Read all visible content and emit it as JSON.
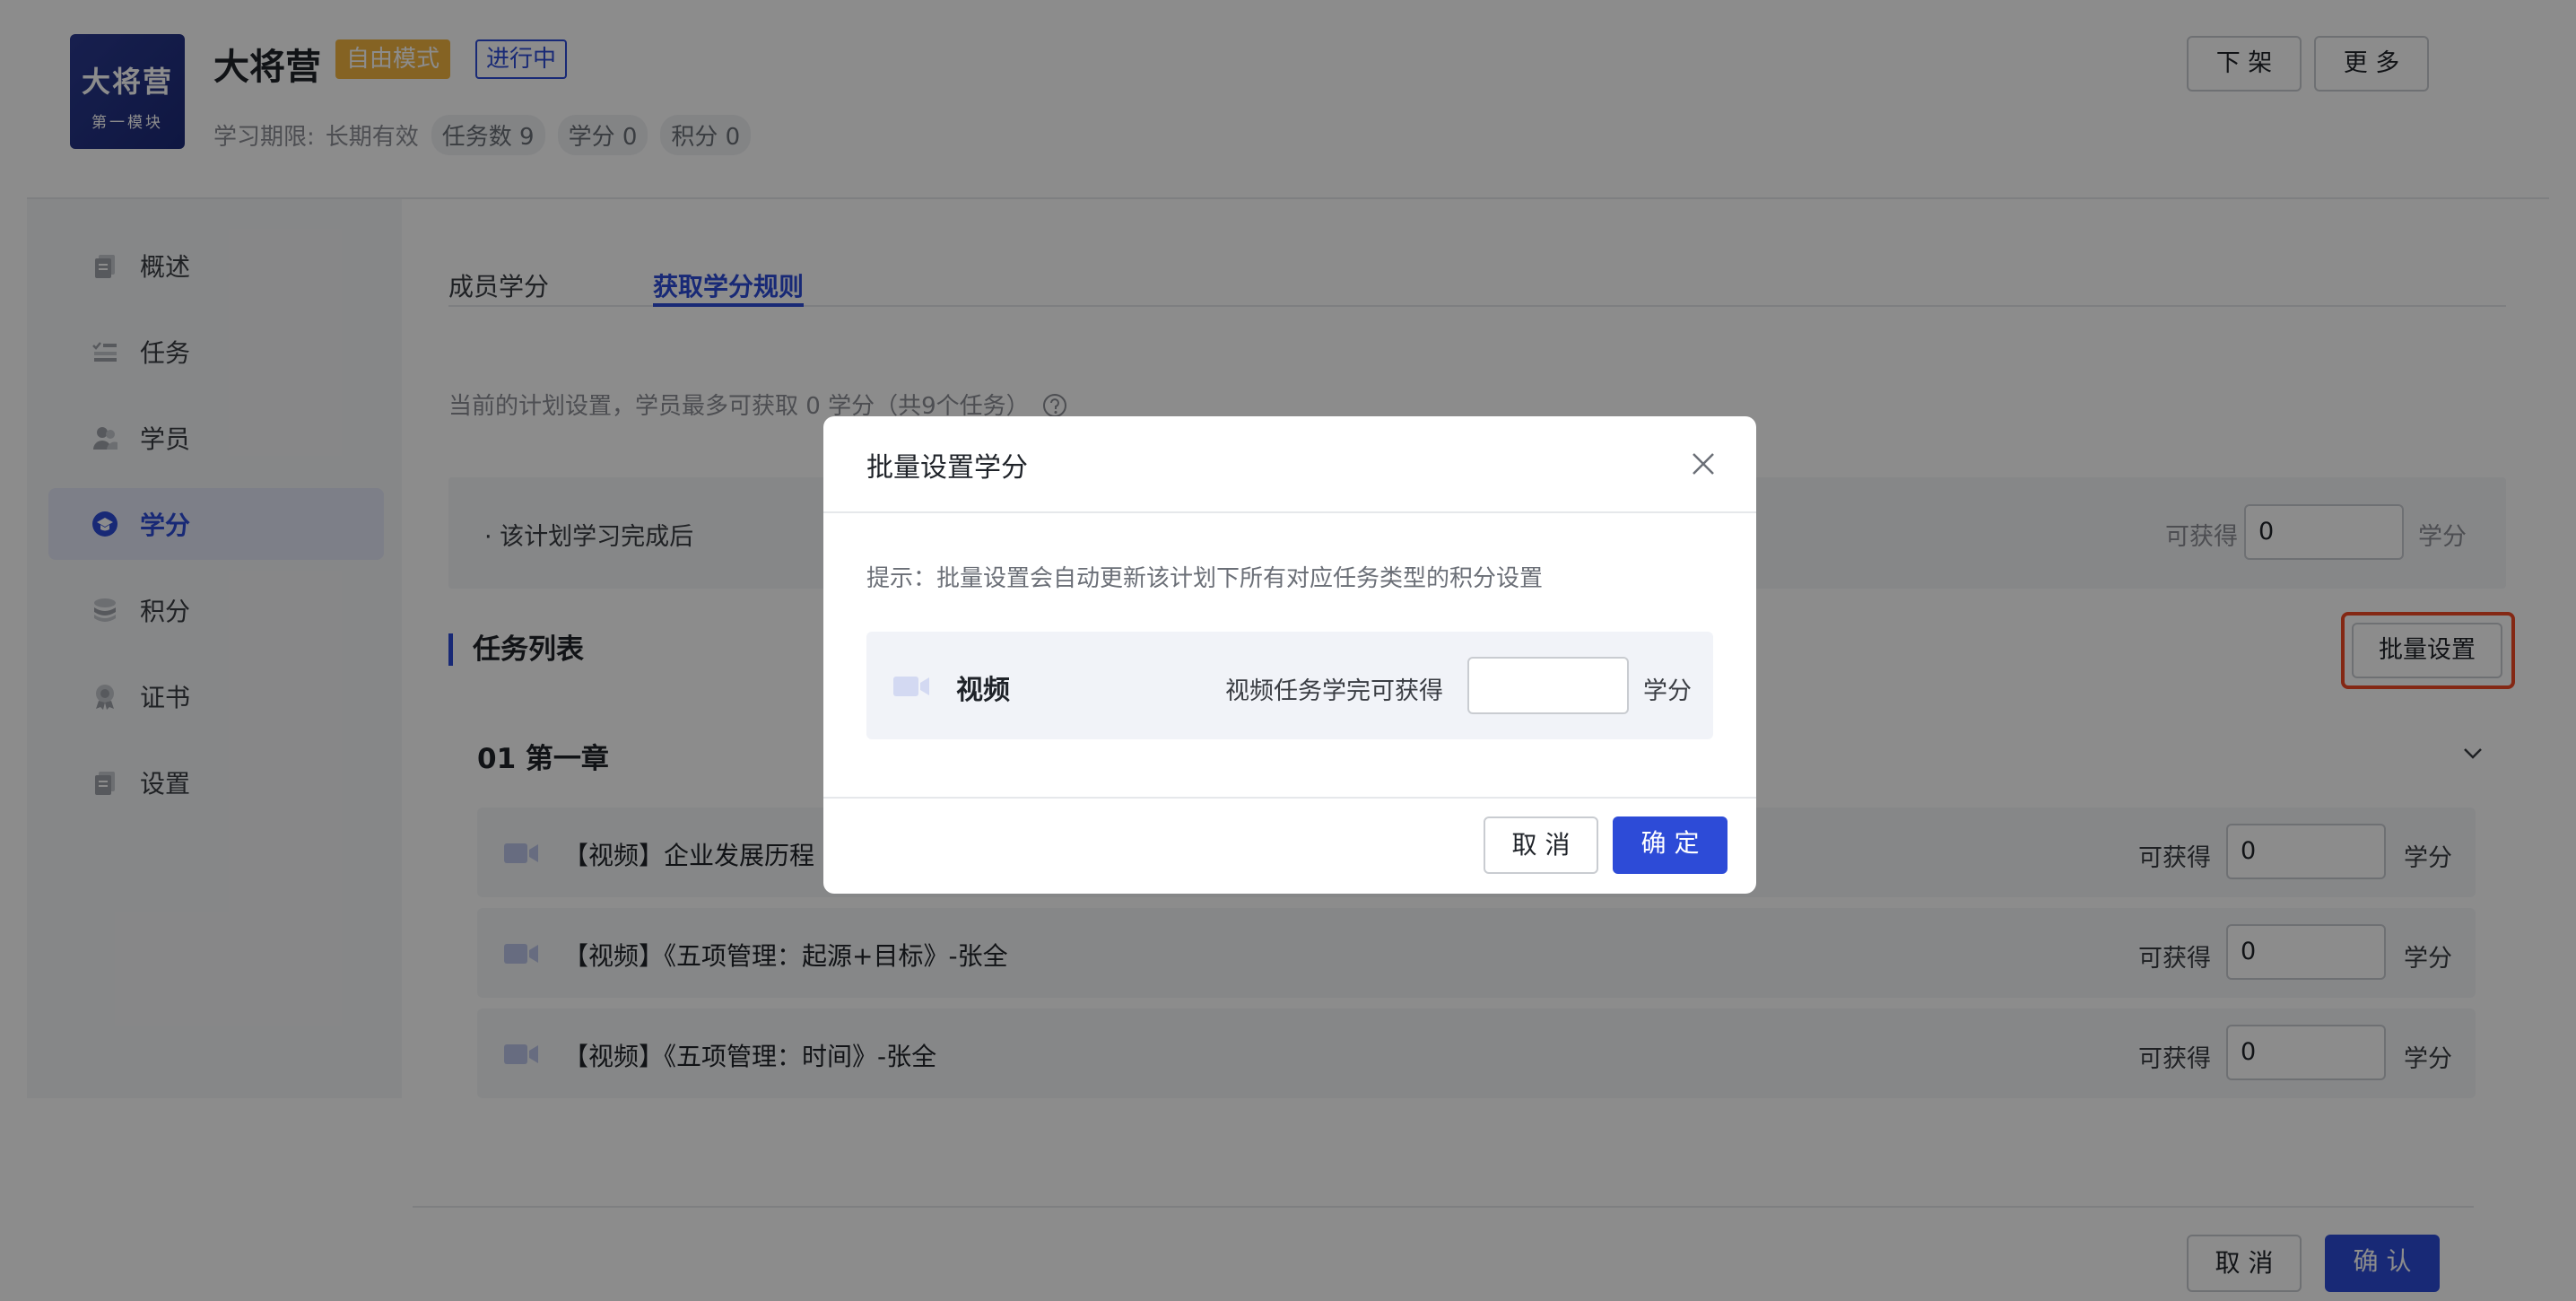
{
  "header": {
    "logo_line1": "大将营",
    "logo_line2": "第一模块",
    "title": "大将营",
    "tag_mode": "自由模式",
    "tag_status": "进行中",
    "period_label": "学习期限:",
    "period_value": "长期有效",
    "task_count": "任务数 9",
    "credit": "学分 0",
    "points": "积分 0",
    "btn_offshelf": "下 架",
    "btn_more": "更 多"
  },
  "sidebar": {
    "items": [
      {
        "label": "概述",
        "icon": "overview-icon"
      },
      {
        "label": "任务",
        "icon": "task-list-icon"
      },
      {
        "label": "学员",
        "icon": "users-icon"
      },
      {
        "label": "学分",
        "icon": "credit-icon",
        "active": true
      },
      {
        "label": "积分",
        "icon": "points-icon"
      },
      {
        "label": "证书",
        "icon": "certificate-icon"
      },
      {
        "label": "设置",
        "icon": "settings-icon"
      }
    ]
  },
  "main": {
    "tabs": [
      {
        "label": "成员学分"
      },
      {
        "label": "获取学分规则",
        "active": true
      }
    ],
    "summary": "当前的计划设置，学员最多可获取 0 学分（共9个任务）",
    "complete_row": {
      "label": "· 该计划学习完成后",
      "prefix": "可获得",
      "value": "0",
      "unit": "学分"
    },
    "section_title": "任务列表",
    "batch_button": "批量设置",
    "chapter": "01  第一章",
    "tasks": [
      {
        "title": "【视频】企业发展历程",
        "prefix": "可获得",
        "value": "0",
        "unit": "学分"
      },
      {
        "title": "【视频】《五项管理：起源+目标》-张全",
        "prefix": "可获得",
        "value": "0",
        "unit": "学分"
      },
      {
        "title": "【视频】《五项管理：时间》-张全",
        "prefix": "可获得",
        "value": "0",
        "unit": "学分"
      }
    ]
  },
  "footer": {
    "cancel": "取 消",
    "confirm": "确 认"
  },
  "modal": {
    "title": "批量设置学分",
    "tip": "提示：批量设置会自动更新该计划下所有对应任务类型的积分设置",
    "row_name": "视频",
    "row_desc": "视频任务学完可获得",
    "row_value": "",
    "row_unit": "学分",
    "cancel": "取 消",
    "ok": "确 定"
  },
  "colors": {
    "primary": "#2d4bd7",
    "tag_mode_bg": "#f2b440",
    "highlight": "#f04a25"
  }
}
